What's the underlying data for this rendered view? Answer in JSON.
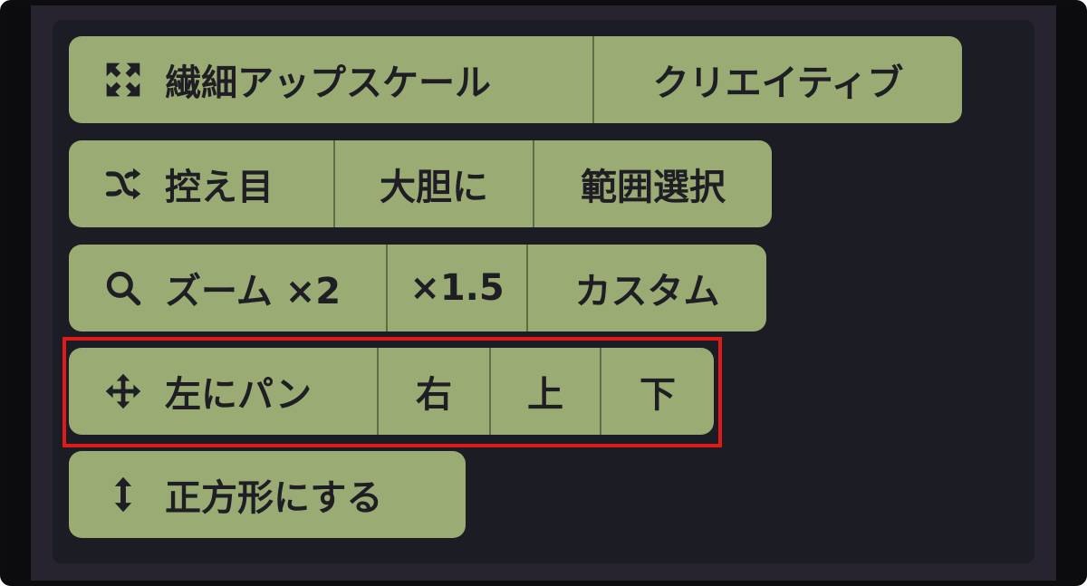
{
  "rows": [
    {
      "icon": "fit-screen-icon",
      "buttons": [
        "繊細アップスケール",
        "クリエイティブ"
      ]
    },
    {
      "icon": "shuffle-icon",
      "buttons": [
        "控え目",
        "大胆に",
        "範囲選択"
      ]
    },
    {
      "icon": "search-icon",
      "buttons": [
        "ズーム ×2",
        "×1.5",
        "カスタム"
      ]
    },
    {
      "icon": "move-arrows-icon",
      "buttons": [
        "左にパン",
        "右",
        "上",
        "下"
      ]
    },
    {
      "icon": "vertical-arrows-icon",
      "buttons": [
        "正方形にする"
      ]
    }
  ],
  "colors": {
    "button_bg": "#9aac74",
    "panel_bg": "#1c1c24",
    "frame_bg": "#27232f",
    "highlight": "#e01a1a",
    "text": "#1e1e24"
  }
}
